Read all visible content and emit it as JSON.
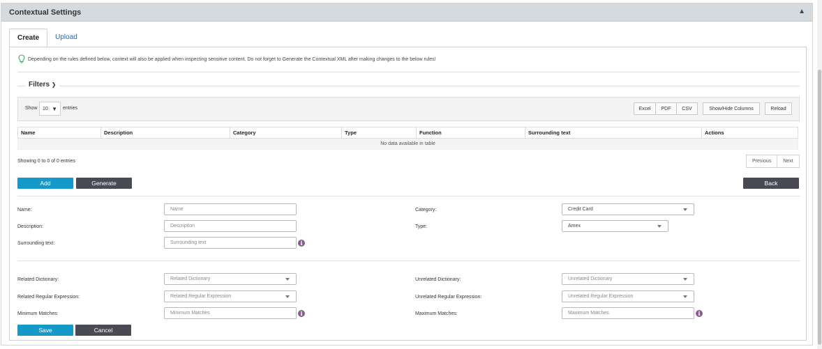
{
  "panel": {
    "title": "Contextual Settings",
    "collapse_icon": "chevron-up-icon"
  },
  "tabs": [
    {
      "label": "Create",
      "active": true
    },
    {
      "label": "Upload",
      "active": false
    }
  ],
  "info": {
    "icon": "lightbulb-icon",
    "text": "Depending on the rules defined below, context will also be applied when inspecting sensitive content. Do not forget to Generate the Contextual XML after making changes to the below rules!"
  },
  "filters": {
    "label": "Filters",
    "icon": "chevron-down-icon"
  },
  "toolbar": {
    "show_label": "Show",
    "entries_value": "10",
    "entries_label": "entries",
    "export_buttons": [
      "Excel",
      "PDF",
      "CSV"
    ],
    "columns_button": "Show/Hide Columns",
    "reload_button": "Reload"
  },
  "table": {
    "columns": [
      "Name",
      "Description",
      "Category",
      "Type",
      "Function",
      "Surrounding text",
      "Actions"
    ],
    "empty_message": "No data available in table"
  },
  "pagination": {
    "info": "Showing 0 to 0 of 0 entries",
    "previous": "Previous",
    "next": "Next"
  },
  "actions": {
    "add": "Add",
    "generate": "Generate",
    "back": "Back"
  },
  "form": {
    "name_label": "Name:",
    "name_placeholder": "Name",
    "description_label": "Description:",
    "description_placeholder": "Description",
    "surrounding_label": "Surrounding text:",
    "surrounding_placeholder": "Surrounding text",
    "category_label": "Category:",
    "category_value": "Credit Card",
    "type_label": "Type:",
    "type_value": "Amex",
    "related_dict_label": "Related Dictionary:",
    "related_dict_placeholder": "Related Dictionary",
    "related_regex_label": "Related Regular Expression:",
    "related_regex_placeholder": "Related Regular Expression",
    "min_matches_label": "Minimum Matches:",
    "min_matches_placeholder": "Minimum Matches",
    "unrelated_dict_label": "Unrelated Dictionary:",
    "unrelated_dict_placeholder": "Unrelated Dictionary",
    "unrelated_regex_label": "Unrelated Regular Expression:",
    "unrelated_regex_placeholder": "Unrelated Regular Expression",
    "max_matches_label": "Maximum Matches:",
    "max_matches_placeholder": "Maximum Matches",
    "info_icon_glyph": "i"
  },
  "footer": {
    "save": "Save",
    "cancel": "Cancel"
  },
  "colors": {
    "primary": "#1599c9",
    "dark": "#4a4a55",
    "info_icon": "#8a5a92",
    "header_bg": "#d5dadf"
  }
}
